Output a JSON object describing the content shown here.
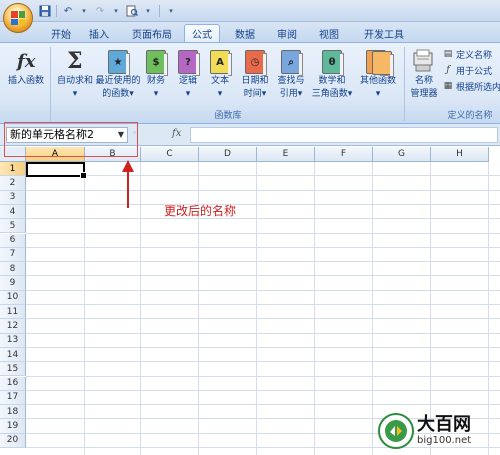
{
  "quick_access": {
    "save_icon": "save-icon",
    "undo_icon": "undo-icon",
    "redo_icon": "redo-icon",
    "print_preview_icon": "print-preview-icon",
    "customize_icon": "chevron-down-icon"
  },
  "tabs": [
    {
      "label": "开始",
      "active": false
    },
    {
      "label": "插入",
      "active": false
    },
    {
      "label": "页面布局",
      "active": false
    },
    {
      "label": "公式",
      "active": true
    },
    {
      "label": "数据",
      "active": false
    },
    {
      "label": "审阅",
      "active": false
    },
    {
      "label": "视图",
      "active": false
    },
    {
      "label": "开发工具",
      "active": false
    }
  ],
  "ribbon": {
    "insert_function": {
      "line1": "插入函数",
      "line2": ""
    },
    "function_library": {
      "group_label": "函数库",
      "buttons": [
        {
          "line1": "自动求和",
          "line2": "▾",
          "icon": "sigma-icon"
        },
        {
          "line1": "最近使用的",
          "line2": "的函数▾",
          "icon": "recent-book-icon"
        },
        {
          "line1": "财务",
          "line2": "▾",
          "icon": "finance-book-icon"
        },
        {
          "line1": "逻辑",
          "line2": "▾",
          "icon": "logic-book-icon"
        },
        {
          "line1": "文本",
          "line2": "▾",
          "icon": "text-book-icon"
        },
        {
          "line1": "日期和",
          "line2": "时间▾",
          "icon": "datetime-book-icon"
        },
        {
          "line1": "查找与",
          "line2": "引用▾",
          "icon": "lookup-book-icon"
        },
        {
          "line1": "数学和",
          "line2": "三角函数▾",
          "icon": "math-book-icon"
        },
        {
          "line1": "其他函数",
          "line2": "▾",
          "icon": "more-functions-icon"
        }
      ]
    },
    "defined_names": {
      "group_label": "定义的名称",
      "name_manager": {
        "line1": "名称",
        "line2": "管理器"
      },
      "define_name": "定义名称",
      "use_in_formula": "用于公式",
      "create_from_selection": "根据所选内"
    }
  },
  "formula_bar": {
    "name_box_value": "新的单元格名称2",
    "fx_label": "fx",
    "formula_value": ""
  },
  "columns": [
    "A",
    "B",
    "C",
    "D",
    "E",
    "F",
    "G",
    "H"
  ],
  "rows": [
    "1",
    "2",
    "3",
    "4",
    "5",
    "6",
    "7",
    "8",
    "9",
    "10",
    "11",
    "12",
    "13",
    "14",
    "15",
    "16",
    "17",
    "18",
    "19",
    "20"
  ],
  "selected_cell": {
    "column": "A",
    "row": "1"
  },
  "annotation": {
    "text": "更改后的名称",
    "color": "#d02020"
  },
  "watermark": {
    "title": "大百网",
    "url": "big100.net"
  },
  "colors": {
    "ribbon_text": "#15428b",
    "annotation_red": "#d02020",
    "highlight_box": "#e05050"
  }
}
